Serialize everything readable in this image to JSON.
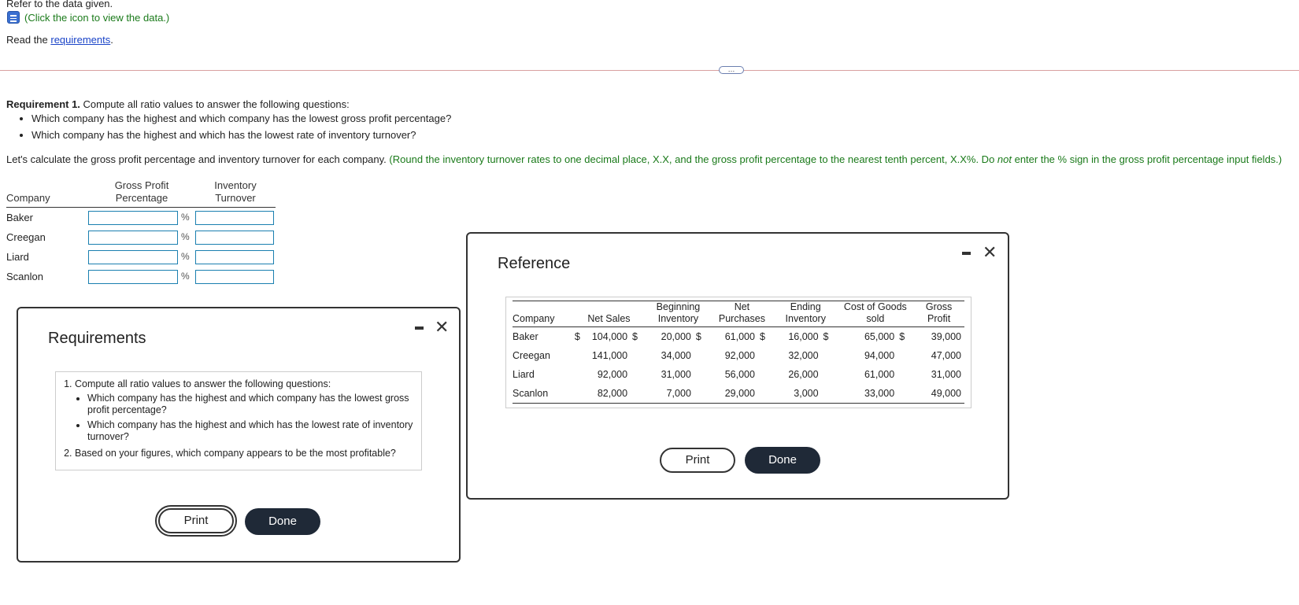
{
  "header": {
    "top_line": "Refer to the data given.",
    "data_link": "(Click the icon to view the data.)",
    "read_prefix": "Read the ",
    "read_link": "requirements",
    "read_suffix": "."
  },
  "expander_label": "…",
  "requirement1": {
    "bold": "Requirement 1.",
    "text": " Compute all ratio values to answer the following questions:",
    "questions": [
      "Which company has the highest and which company has the lowest gross profit percentage?",
      "Which company has the highest and which has the lowest rate of inventory turnover?"
    ]
  },
  "instruction": {
    "text": "Let's calculate the gross profit percentage and inventory turnover for each company.",
    "hint_part1": " (Round the inventory turnover rates to one decimal place, X.X, and the gross profit percentage to the nearest tenth percent, X.X%. Do ",
    "hint_em": "not",
    "hint_part2": " enter the % sign in the gross profit percentage input fields.)"
  },
  "calc_table": {
    "col_company": "Company",
    "col_gpp_1": "Gross Profit",
    "col_gpp_2": "Percentage",
    "col_inv_1": "Inventory",
    "col_inv_2": "Turnover",
    "percent_sign": "%",
    "rows": [
      {
        "company": "Baker",
        "gpp": "",
        "inv": ""
      },
      {
        "company": "Creegan",
        "gpp": "",
        "inv": ""
      },
      {
        "company": "Liard",
        "gpp": "",
        "inv": ""
      },
      {
        "company": "Scanlon",
        "gpp": "",
        "inv": ""
      }
    ]
  },
  "requirements_modal": {
    "title": "Requirements",
    "item1": "Compute all ratio values to answer the following questions:",
    "item1_bullets": [
      "Which company has the highest and which company has the lowest gross profit percentage?",
      "Which company has the highest and which has the lowest rate of inventory turnover?"
    ],
    "item2": "Based on your figures, which company appears to be the most profitable?",
    "print_label": "Print",
    "done_label": "Done"
  },
  "reference_modal": {
    "title": "Reference",
    "headers": {
      "company": "Company",
      "net_sales": "Net Sales",
      "beg_inv_1": "Beginning",
      "beg_inv_2": "Inventory",
      "net_pur_1": "Net",
      "net_pur_2": "Purchases",
      "end_inv_1": "Ending",
      "end_inv_2": "Inventory",
      "cogs_1": "Cost of Goods",
      "cogs_2": "sold",
      "gp_1": "Gross",
      "gp_2": "Profit"
    },
    "dollar": "$",
    "rows": [
      {
        "company": "Baker",
        "net_sales": "104,000",
        "beg_inv": "20,000",
        "net_pur": "61,000",
        "end_inv": "16,000",
        "cogs": "65,000",
        "gp": "39,000"
      },
      {
        "company": "Creegan",
        "net_sales": "141,000",
        "beg_inv": "34,000",
        "net_pur": "92,000",
        "end_inv": "32,000",
        "cogs": "94,000",
        "gp": "47,000"
      },
      {
        "company": "Liard",
        "net_sales": "92,000",
        "beg_inv": "31,000",
        "net_pur": "56,000",
        "end_inv": "26,000",
        "cogs": "61,000",
        "gp": "31,000"
      },
      {
        "company": "Scanlon",
        "net_sales": "82,000",
        "beg_inv": "7,000",
        "net_pur": "29,000",
        "end_inv": "3,000",
        "cogs": "33,000",
        "gp": "49,000"
      }
    ],
    "print_label": "Print",
    "done_label": "Done"
  },
  "icons": {
    "data_icon": "data-table-icon",
    "minimize": "minimize-icon",
    "close": "close-icon"
  }
}
